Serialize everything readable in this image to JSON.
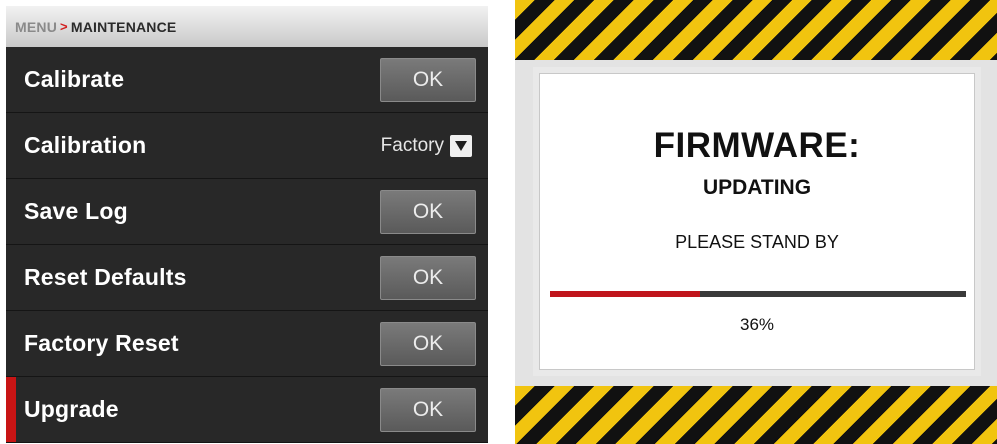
{
  "maintenance_menu": {
    "breadcrumb": {
      "root": "MENU",
      "separator": ">",
      "current": "MAINTENANCE"
    },
    "rows": [
      {
        "label": "Calibrate",
        "control": "button",
        "button_label": "OK"
      },
      {
        "label": "Calibration",
        "control": "dropdown",
        "value": "Factory",
        "icon": "chevron-down-icon"
      },
      {
        "label": "Save Log",
        "control": "button",
        "button_label": "OK"
      },
      {
        "label": "Reset Defaults",
        "control": "button",
        "button_label": "OK"
      },
      {
        "label": "Factory Reset",
        "control": "button",
        "button_label": "OK"
      },
      {
        "label": "Upgrade",
        "control": "button",
        "button_label": "OK",
        "active": true
      }
    ],
    "colors": {
      "background": "#262626",
      "active_marker": "#c81515",
      "breadcrumb_accent": "#d21f1f"
    }
  },
  "firmware_update": {
    "title": "FIRMWARE:",
    "status": "UPDATING",
    "message": "PLEASE STAND BY",
    "progress_percent": 36,
    "progress_label": "36%",
    "colors": {
      "hazard_yellow": "#f1c40f",
      "hazard_black": "#111111",
      "progress_fill": "#c0151c",
      "progress_track": "#3a3a3a"
    }
  }
}
